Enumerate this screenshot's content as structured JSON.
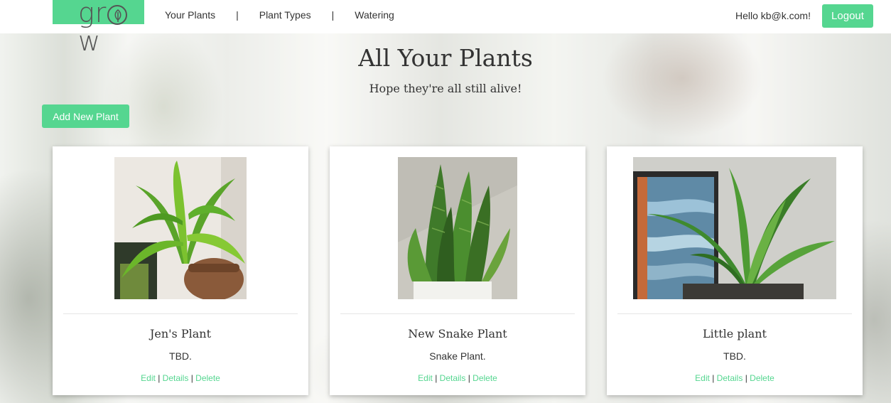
{
  "nav": {
    "logo": "grow",
    "links": [
      "Your Plants",
      "Plant Types",
      "Watering"
    ],
    "separator": "|",
    "greeting": "Hello kb@k.com!",
    "logout": "Logout"
  },
  "header": {
    "title": "All Your Plants",
    "subtitle": "Hope they're all still alive!"
  },
  "add_button": "Add New Plant",
  "plants": [
    {
      "name": "Jen's Plant",
      "type": "TBD.",
      "actions": [
        "Edit",
        "Details",
        "Delete"
      ],
      "action_sep": "|"
    },
    {
      "name": "New Snake Plant",
      "type": "Snake Plant.",
      "actions": [
        "Edit",
        "Details",
        "Delete"
      ],
      "action_sep": "|"
    },
    {
      "name": "Little plant",
      "type": "TBD.",
      "actions": [
        "Edit",
        "Details",
        "Delete"
      ],
      "action_sep": "|"
    }
  ],
  "colors": {
    "accent": "#55d690",
    "text": "#333333"
  }
}
